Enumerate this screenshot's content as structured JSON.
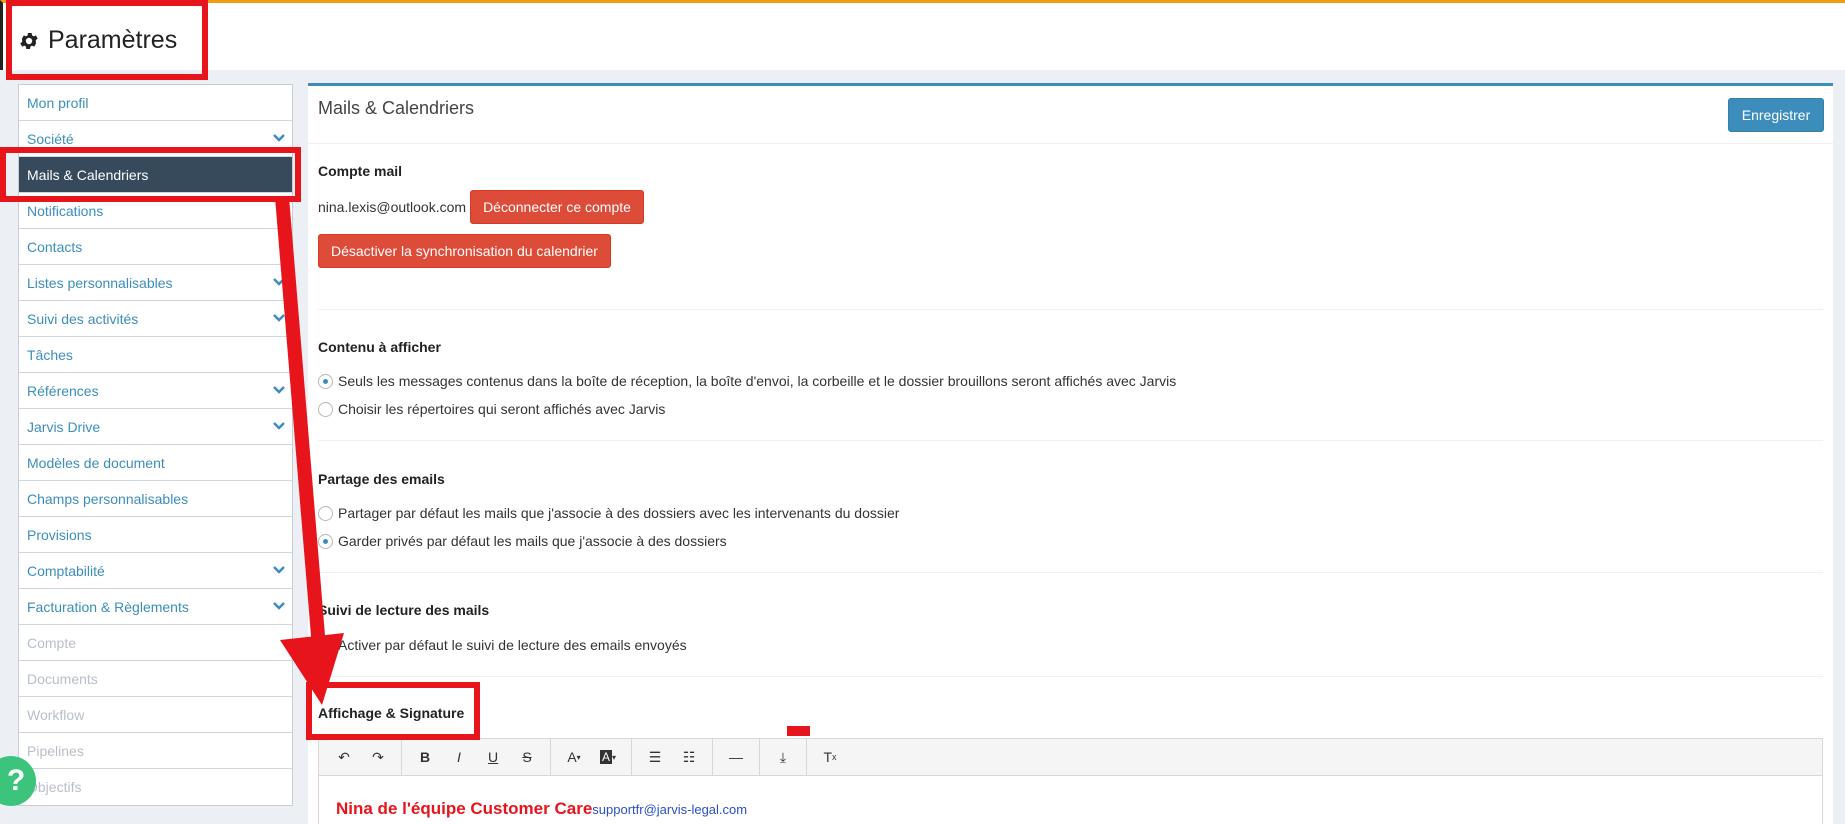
{
  "header": {
    "title": "Paramètres",
    "icon": "gear-icon"
  },
  "sidebar": {
    "items": [
      {
        "label": "Mon profil",
        "state": "normal",
        "chevron": false
      },
      {
        "label": "Société",
        "state": "normal",
        "chevron": true
      },
      {
        "label": "Mails & Calendriers",
        "state": "active",
        "chevron": false
      },
      {
        "label": "Notifications",
        "state": "normal",
        "chevron": false
      },
      {
        "label": "Contacts",
        "state": "normal",
        "chevron": false
      },
      {
        "label": "Listes personnalisables",
        "state": "normal",
        "chevron": true
      },
      {
        "label": "Suivi des activités",
        "state": "normal",
        "chevron": true
      },
      {
        "label": "Tâches",
        "state": "normal",
        "chevron": false
      },
      {
        "label": "Références",
        "state": "normal",
        "chevron": true
      },
      {
        "label": "Jarvis Drive",
        "state": "normal",
        "chevron": true
      },
      {
        "label": "Modèles de document",
        "state": "normal",
        "chevron": false
      },
      {
        "label": "Champs personnalisables",
        "state": "normal",
        "chevron": false
      },
      {
        "label": "Provisions",
        "state": "normal",
        "chevron": false
      },
      {
        "label": "Comptabilité",
        "state": "normal",
        "chevron": true
      },
      {
        "label": "Facturation & Règlements",
        "state": "normal",
        "chevron": true
      },
      {
        "label": "Compte",
        "state": "disabled",
        "chevron": false
      },
      {
        "label": "Documents",
        "state": "disabled",
        "chevron": false
      },
      {
        "label": "Workflow",
        "state": "disabled",
        "chevron": false
      },
      {
        "label": "Pipelines",
        "state": "disabled",
        "chevron": false
      },
      {
        "label": "Objectifs",
        "state": "disabled",
        "chevron": false
      }
    ]
  },
  "panel": {
    "title": "Mails & Calendriers",
    "save_label": "Enregistrer",
    "mail_account": {
      "title": "Compte mail",
      "email": "nina.lexis@outlook.com",
      "disconnect_label": "Déconnecter ce compte",
      "disable_sync_label": "Désactiver la synchronisation du calendrier"
    },
    "content": {
      "title": "Contenu à afficher",
      "options": [
        {
          "label": "Seuls les messages contenus dans la boîte de réception, la boîte d'envoi, la corbeille et le dossier brouillons seront affichés avec Jarvis",
          "checked": true
        },
        {
          "label": "Choisir les répertoires qui seront affichés avec Jarvis",
          "checked": false
        }
      ]
    },
    "sharing": {
      "title": "Partage des emails",
      "options": [
        {
          "label": "Partager par défaut les mails que j'associe à des dossiers avec les intervenants du dossier",
          "checked": false
        },
        {
          "label": "Garder privés par défaut les mails que j'associe à des dossiers",
          "checked": true
        }
      ]
    },
    "tracking": {
      "title": "Suivi de lecture des mails",
      "option_label": "Activer par défaut le suivi de lecture des emails envoyés"
    },
    "signature": {
      "title": "Affichage & Signature",
      "name": "Nina de l'équipe Customer Care",
      "email": "supportfr@jarvis-legal.com"
    }
  },
  "colors": {
    "accent_orange": "#f39c12",
    "primary_blue": "#3c8dbc",
    "danger_red": "#dd4b39",
    "sidebar_active": "#364a5c",
    "annotation_red": "#e8141b",
    "help_green": "#3cc47c"
  },
  "help_button": {
    "label": "?"
  }
}
